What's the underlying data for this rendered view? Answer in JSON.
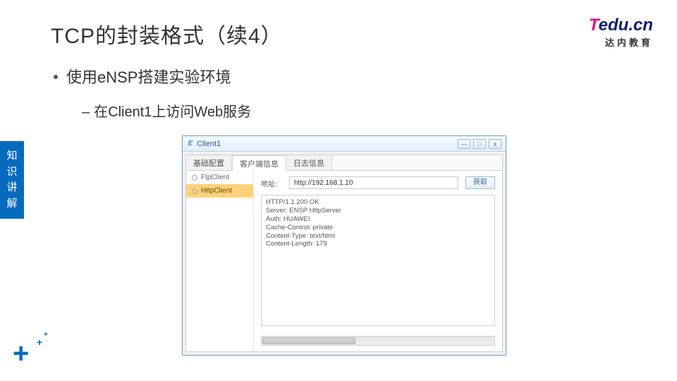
{
  "title": "TCP的封装格式（续4）",
  "logo": {
    "t": "T",
    "edu": "edu",
    "dot": ".",
    "cn": "cn",
    "sub": "达内教育"
  },
  "bullet1": "使用eNSP搭建实验环境",
  "bullet2": "在Client1上访问Web服务",
  "sidetab": [
    "知",
    "识",
    "讲",
    "解"
  ],
  "window": {
    "title": "Client1",
    "ctrls": {
      "min": "—",
      "max": "□",
      "close": "x"
    },
    "tabs": [
      "基础配置",
      "客户端信息",
      "日志信息"
    ],
    "active_tab_index": 1,
    "left_items": [
      {
        "label": "FtpClient",
        "active": false
      },
      {
        "label": "HttpClient",
        "active": true
      }
    ],
    "addr_label": "地址:",
    "addr_value": "http://192.168.1.10",
    "get_btn": "获取",
    "response": [
      "HTTP/1.1 200 OK",
      "Server: ENSP HttpServer",
      "Auth: HUAWEI",
      "Cache-Control: private",
      "Content-Type: text/html",
      "Content-Length: 179"
    ]
  }
}
